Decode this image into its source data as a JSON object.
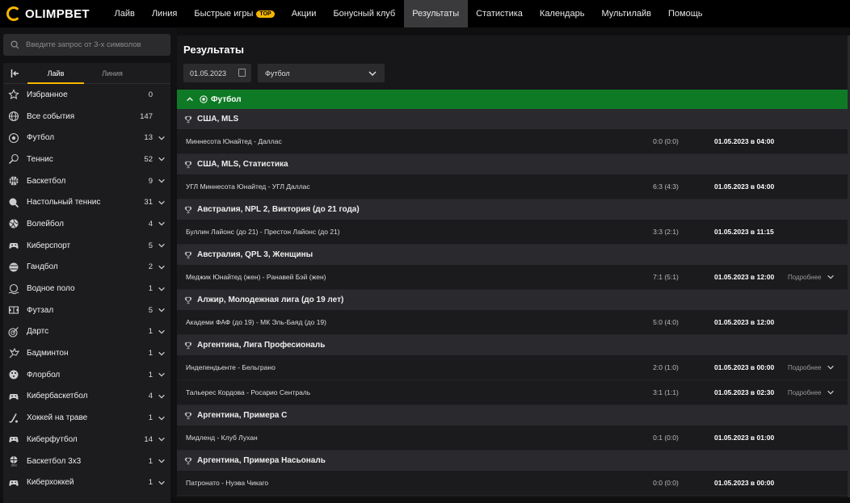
{
  "header": {
    "logo": "OLIMPBET",
    "nav": [
      {
        "label": "Лайв"
      },
      {
        "label": "Линия"
      },
      {
        "label": "Быстрые игры",
        "badge": "TOP"
      },
      {
        "label": "Акции"
      },
      {
        "label": "Бонусный клуб"
      },
      {
        "label": "Результаты",
        "active": true
      },
      {
        "label": "Статистика"
      },
      {
        "label": "Календарь"
      },
      {
        "label": "Мультилайв"
      },
      {
        "label": "Помощь"
      }
    ]
  },
  "sidebar": {
    "search_placeholder": "Введите запрос от 3-х символов",
    "tabs": {
      "live": "Лайв",
      "line": "Линия"
    },
    "items": [
      {
        "label": "Избранное",
        "count": "0",
        "icon": "star-icon",
        "chevron": false
      },
      {
        "label": "Все события",
        "count": "147",
        "icon": "globe-icon",
        "chevron": false
      },
      {
        "label": "Футбол",
        "count": "13",
        "icon": "soccer-ball-icon",
        "chevron": true
      },
      {
        "label": "Теннис",
        "count": "52",
        "icon": "tennis-racket-icon",
        "chevron": true
      },
      {
        "label": "Баскетбол",
        "count": "9",
        "icon": "basketball-icon",
        "chevron": true
      },
      {
        "label": "Настольный теннис",
        "count": "31",
        "icon": "table-tennis-icon",
        "chevron": true
      },
      {
        "label": "Волейбол",
        "count": "4",
        "icon": "volleyball-icon",
        "chevron": true
      },
      {
        "label": "Киберспорт",
        "count": "5",
        "icon": "gamepad-icon",
        "chevron": true
      },
      {
        "label": "Гандбол",
        "count": "2",
        "icon": "handball-icon",
        "chevron": true
      },
      {
        "label": "Водное поло",
        "count": "1",
        "icon": "water-polo-icon",
        "chevron": true
      },
      {
        "label": "Футзал",
        "count": "5",
        "icon": "futsal-icon",
        "chevron": true
      },
      {
        "label": "Дартс",
        "count": "1",
        "icon": "darts-icon",
        "chevron": true
      },
      {
        "label": "Бадминтон",
        "count": "1",
        "icon": "shuttlecock-icon",
        "chevron": true
      },
      {
        "label": "Флорбол",
        "count": "1",
        "icon": "floorball-icon",
        "chevron": true
      },
      {
        "label": "Кибербаскетбол",
        "count": "4",
        "icon": "gamepad-icon",
        "chevron": true
      },
      {
        "label": "Хоккей на траве",
        "count": "1",
        "icon": "hockey-stick-icon",
        "chevron": true
      },
      {
        "label": "Киберфутбол",
        "count": "14",
        "icon": "gamepad-icon",
        "chevron": true
      },
      {
        "label": "Баскетбол 3х3",
        "count": "1",
        "icon": "basketball-3x3-icon",
        "chevron": true
      },
      {
        "label": "Киберхоккей",
        "count": "1",
        "icon": "gamepad-icon",
        "chevron": true
      }
    ]
  },
  "main": {
    "title": "Результаты",
    "date": "01.05.2023",
    "sport_select": "Футбол",
    "sport_header": "Футбол",
    "leagues": [
      {
        "name": "США, MLS",
        "matches": [
          {
            "teams": "Миннесота Юнайтед - Даллас",
            "score": "0:0 (0:0)",
            "datetime": "01.05.2023 в 04:00",
            "more": ""
          }
        ]
      },
      {
        "name": "США, MLS, Статистика",
        "matches": [
          {
            "teams": "УГЛ Миннесота Юнайтед - УГЛ Даллас",
            "score": "6:3 (4:3)",
            "datetime": "01.05.2023 в 04:00",
            "more": ""
          }
        ]
      },
      {
        "name": "Австралия, NPL 2, Виктория (до 21 года)",
        "matches": [
          {
            "teams": "Буллин Лайонс (до 21) - Престон Лайонс (до 21)",
            "score": "3:3 (2:1)",
            "datetime": "01.05.2023 в 11:15",
            "more": ""
          }
        ]
      },
      {
        "name": "Австралия, QPL 3, Женщины",
        "matches": [
          {
            "teams": "Меджик Юнайтед (жен) - Ранавей Бэй (жен)",
            "score": "7:1 (5:1)",
            "datetime": "01.05.2023 в 12:00",
            "more": "Подробнее"
          }
        ]
      },
      {
        "name": "Алжир, Молодежная лига (до 19 лет)",
        "matches": [
          {
            "teams": "Академи ФАФ (до 19) - МК Эль-Баяд (до 19)",
            "score": "5:0 (4:0)",
            "datetime": "01.05.2023 в 12:00",
            "more": ""
          }
        ]
      },
      {
        "name": "Аргентина, Лига Професиональ",
        "matches": [
          {
            "teams": "Индепендьенте - Бельграно",
            "score": "2:0 (1:0)",
            "datetime": "01.05.2023 в 00:00",
            "more": "Подробнее"
          },
          {
            "teams": "Тальерес Кордова - Росарио Сентраль",
            "score": "3:1 (1:1)",
            "datetime": "01.05.2023 в 02:30",
            "more": "Подробнее"
          }
        ]
      },
      {
        "name": "Аргентина, Примера С",
        "matches": [
          {
            "teams": "Мидленд - Клуб Лухан",
            "score": "0:1 (0:0)",
            "datetime": "01.05.2023 в 01:00",
            "more": ""
          }
        ]
      },
      {
        "name": "Аргентина, Примера Насьональ",
        "matches": [
          {
            "teams": "Патронато - Нуэва Чикаго",
            "score": "0:0 (0:0)",
            "datetime": "01.05.2023 в 00:00",
            "more": ""
          }
        ]
      }
    ]
  }
}
